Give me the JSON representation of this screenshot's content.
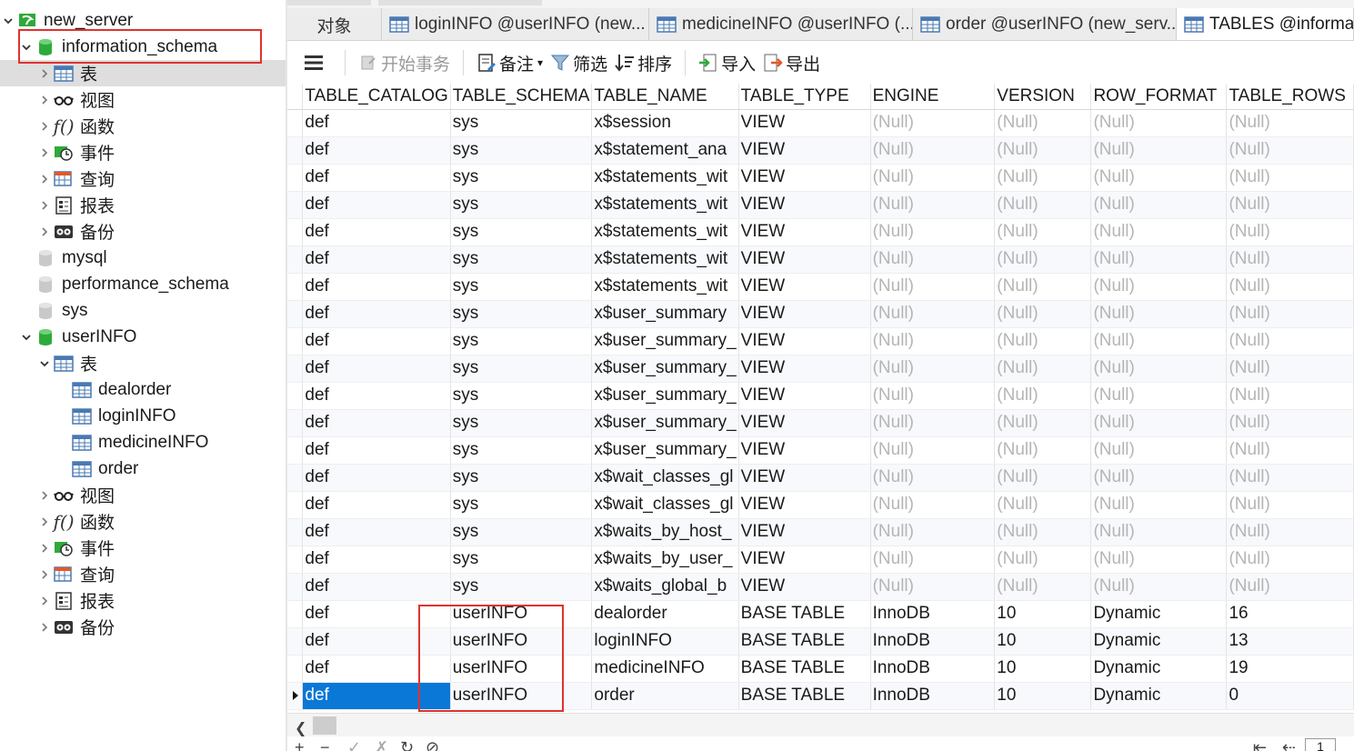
{
  "sidebar": {
    "connection": "new_server",
    "databases": [
      {
        "name": "information_schema",
        "expanded": true
      },
      {
        "name": "mysql",
        "expanded": false
      },
      {
        "name": "performance_schema",
        "expanded": false
      },
      {
        "name": "sys",
        "expanded": false
      },
      {
        "name": "userINFO",
        "expanded": true
      }
    ],
    "object_groups": [
      "表",
      "视图",
      "函数",
      "事件",
      "查询",
      "报表",
      "备份"
    ],
    "user_tables": [
      "dealorder",
      "loginINFO",
      "medicineINFO",
      "order"
    ]
  },
  "tabs": [
    {
      "label": "对象",
      "icon": "none"
    },
    {
      "label": "loginINFO @userINFO (new...",
      "icon": "table-icon"
    },
    {
      "label": "medicineINFO @userINFO (...",
      "icon": "table-icon"
    },
    {
      "label": "order @userINFO (new_serv...",
      "icon": "table-icon"
    },
    {
      "label": "TABLES @informat",
      "icon": "table-icon",
      "active": true
    }
  ],
  "toolbar": {
    "menu": "menu-icon",
    "begin_transaction": "开始事务",
    "comment": "备注",
    "filter": "筛选",
    "sort": "排序",
    "import": "导入",
    "export": "导出"
  },
  "grid": {
    "columns": [
      "TABLE_CATALOG",
      "TABLE_SCHEMA",
      "TABLE_NAME",
      "TABLE_TYPE",
      "ENGINE",
      "VERSION",
      "ROW_FORMAT",
      "TABLE_ROWS"
    ],
    "null_text": "(Null)",
    "rows": [
      [
        "def",
        "sys",
        "x$session",
        "VIEW",
        "(Null)",
        "(Null)",
        "(Null)",
        "(Null)"
      ],
      [
        "def",
        "sys",
        "x$statement_ana",
        "VIEW",
        "(Null)",
        "(Null)",
        "(Null)",
        "(Null)"
      ],
      [
        "def",
        "sys",
        "x$statements_wit",
        "VIEW",
        "(Null)",
        "(Null)",
        "(Null)",
        "(Null)"
      ],
      [
        "def",
        "sys",
        "x$statements_wit",
        "VIEW",
        "(Null)",
        "(Null)",
        "(Null)",
        "(Null)"
      ],
      [
        "def",
        "sys",
        "x$statements_wit",
        "VIEW",
        "(Null)",
        "(Null)",
        "(Null)",
        "(Null)"
      ],
      [
        "def",
        "sys",
        "x$statements_wit",
        "VIEW",
        "(Null)",
        "(Null)",
        "(Null)",
        "(Null)"
      ],
      [
        "def",
        "sys",
        "x$statements_wit",
        "VIEW",
        "(Null)",
        "(Null)",
        "(Null)",
        "(Null)"
      ],
      [
        "def",
        "sys",
        "x$user_summary",
        "VIEW",
        "(Null)",
        "(Null)",
        "(Null)",
        "(Null)"
      ],
      [
        "def",
        "sys",
        "x$user_summary_",
        "VIEW",
        "(Null)",
        "(Null)",
        "(Null)",
        "(Null)"
      ],
      [
        "def",
        "sys",
        "x$user_summary_",
        "VIEW",
        "(Null)",
        "(Null)",
        "(Null)",
        "(Null)"
      ],
      [
        "def",
        "sys",
        "x$user_summary_",
        "VIEW",
        "(Null)",
        "(Null)",
        "(Null)",
        "(Null)"
      ],
      [
        "def",
        "sys",
        "x$user_summary_",
        "VIEW",
        "(Null)",
        "(Null)",
        "(Null)",
        "(Null)"
      ],
      [
        "def",
        "sys",
        "x$user_summary_",
        "VIEW",
        "(Null)",
        "(Null)",
        "(Null)",
        "(Null)"
      ],
      [
        "def",
        "sys",
        "x$wait_classes_gl",
        "VIEW",
        "(Null)",
        "(Null)",
        "(Null)",
        "(Null)"
      ],
      [
        "def",
        "sys",
        "x$wait_classes_gl",
        "VIEW",
        "(Null)",
        "(Null)",
        "(Null)",
        "(Null)"
      ],
      [
        "def",
        "sys",
        "x$waits_by_host_",
        "VIEW",
        "(Null)",
        "(Null)",
        "(Null)",
        "(Null)"
      ],
      [
        "def",
        "sys",
        "x$waits_by_user_",
        "VIEW",
        "(Null)",
        "(Null)",
        "(Null)",
        "(Null)"
      ],
      [
        "def",
        "sys",
        "x$waits_global_b",
        "VIEW",
        "(Null)",
        "(Null)",
        "(Null)",
        "(Null)"
      ],
      [
        "def",
        "userINFO",
        "dealorder",
        "BASE TABLE",
        "InnoDB",
        "10",
        "Dynamic",
        "16"
      ],
      [
        "def",
        "userINFO",
        "loginINFO",
        "BASE TABLE",
        "InnoDB",
        "10",
        "Dynamic",
        "13"
      ],
      [
        "def",
        "userINFO",
        "medicineINFO",
        "BASE TABLE",
        "InnoDB",
        "10",
        "Dynamic",
        "19"
      ],
      [
        "def",
        "userINFO",
        "order",
        "BASE TABLE",
        "InnoDB",
        "10",
        "Dynamic",
        "0"
      ]
    ]
  },
  "statusbar": {
    "add": "+",
    "remove": "−",
    "page": "1"
  },
  "colors": {
    "selection": "#0a78d7",
    "annotation_red": "#e0322f",
    "db_green": "#2faa3a",
    "null_grey": "#b5b5b5"
  }
}
